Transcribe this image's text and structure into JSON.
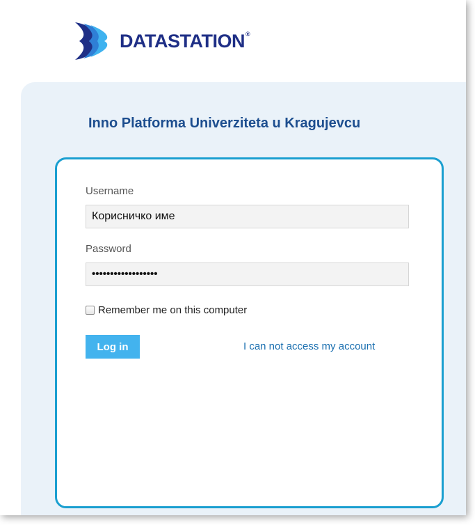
{
  "brand": {
    "name": "DATASTATION",
    "registered_mark": "®",
    "color": "#1f2f86"
  },
  "page": {
    "title": "Inno Platforma Univerziteta u Kragujevcu"
  },
  "login_form": {
    "username_label": "Username",
    "username_value": "Корисничко име",
    "password_label": "Password",
    "password_value": "••••••••••••••••••",
    "remember_label": "Remember me on this computer",
    "remember_checked": false,
    "login_button": "Log in",
    "forgot_link": "I can not access my account"
  },
  "colors": {
    "accent_border": "#1a9fd0",
    "button": "#43b3ee",
    "link": "#1a6fb0",
    "panel_bg": "#eaf2f9"
  }
}
